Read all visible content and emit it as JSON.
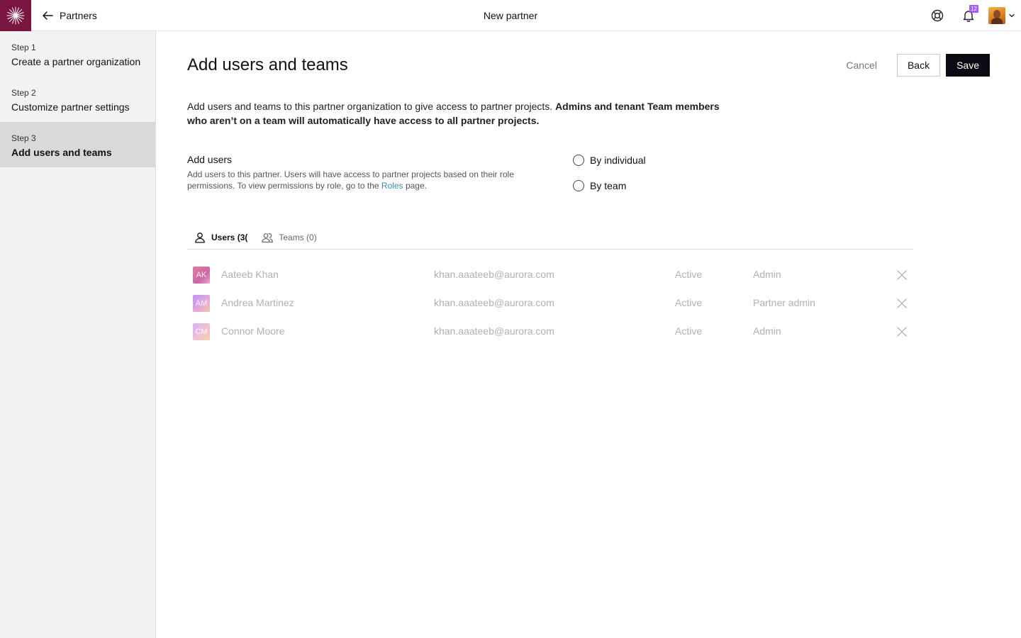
{
  "topbar": {
    "back_label": "Partners",
    "title": "New partner",
    "notification_count": "12"
  },
  "sidebar": {
    "steps": [
      {
        "number": "Step 1",
        "title": "Create a partner organization",
        "active": false
      },
      {
        "number": "Step 2",
        "title": "Customize partner settings",
        "active": false
      },
      {
        "number": "Step 3",
        "title": "Add users and teams",
        "active": true
      }
    ]
  },
  "main": {
    "title": "Add users and teams",
    "actions": {
      "cancel": "Cancel",
      "back": "Back",
      "save": "Save"
    },
    "intro_text": "Add users and teams to this partner organization to give access to partner projects.",
    "intro_bold": "Admins and tenant Team members who aren’t on a team will automatically have access to all partner projects.",
    "add_users": {
      "title": "Add users",
      "desc_before": "Add users to this partner. Users will have access to partner projects based on their role permissions. To view permissions by role, go to the",
      "link": "Roles",
      "desc_after": "page."
    },
    "radios": [
      {
        "label": "By individual"
      },
      {
        "label": "By team"
      }
    ],
    "tabs": [
      {
        "label": "Users (3(",
        "active": true
      },
      {
        "label": "Teams (0)",
        "active": false
      }
    ],
    "users": [
      {
        "initials": "AK",
        "name": "Aateeb Khan",
        "email": "khan.aaateeb@aurora.com",
        "status": "Active",
        "role": "Admin"
      },
      {
        "initials": "AM",
        "name": "Andrea Martinez",
        "email": "khan.aaateeb@aurora.com",
        "status": "Active",
        "role": "Partner admin"
      },
      {
        "initials": "CM",
        "name": "Connor Moore",
        "email": "khan.aaateeb@aurora.com",
        "status": "Active",
        "role": "Admin"
      }
    ]
  },
  "colors": {
    "brand": "#7a1640",
    "primary_button": "#0b0b14",
    "link": "#2f8fa5",
    "badge": "#a35cf5"
  }
}
